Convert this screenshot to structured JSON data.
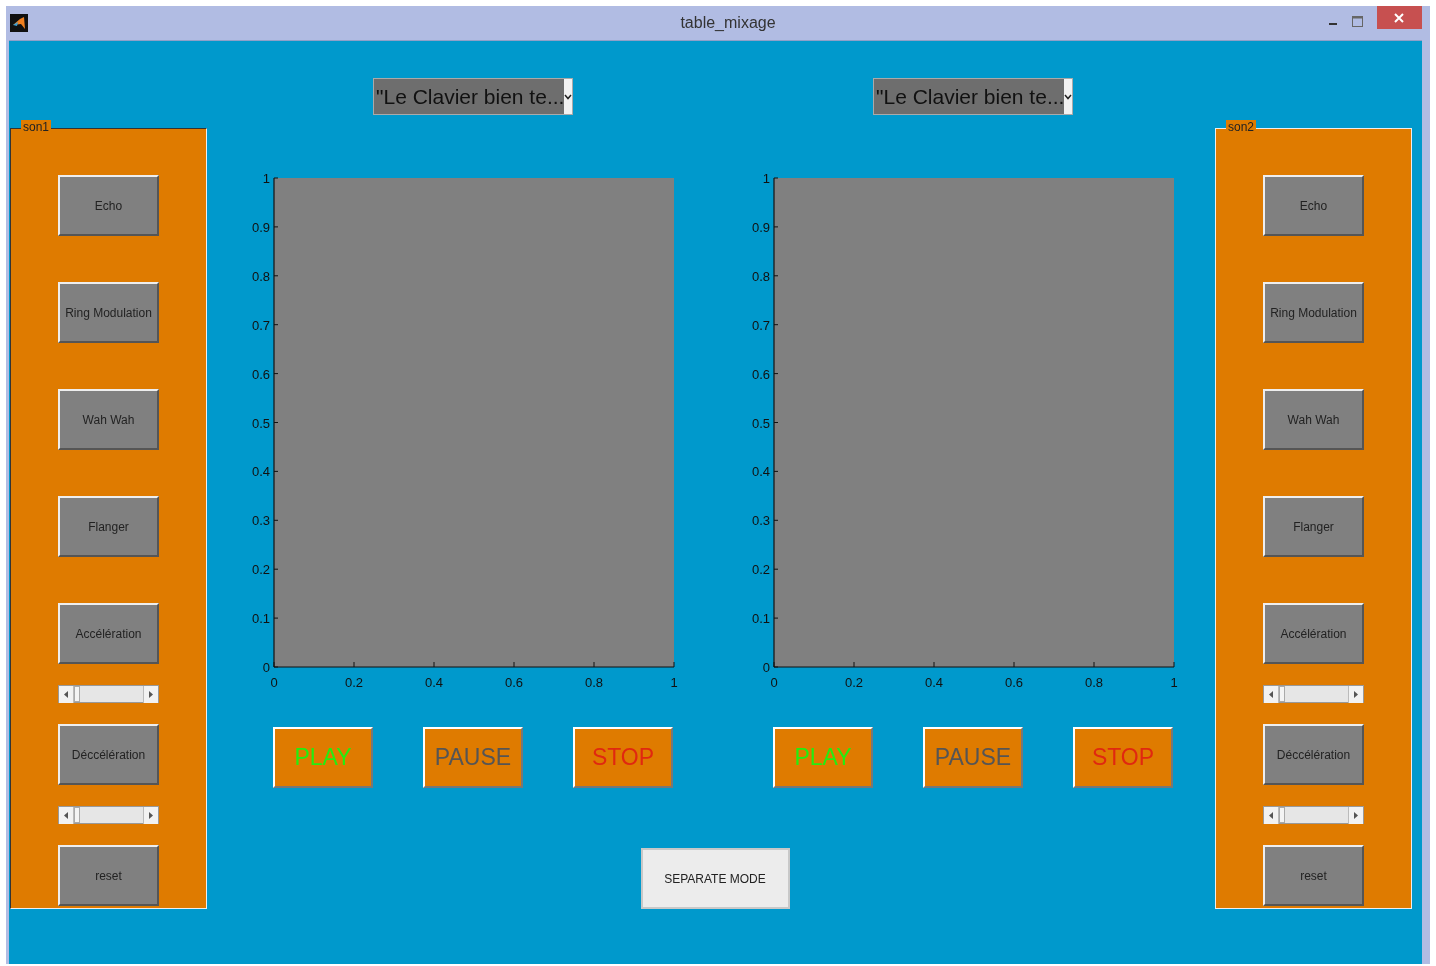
{
  "window": {
    "title": "table_mixage"
  },
  "panels": [
    {
      "title": "son1",
      "items": [
        {
          "kind": "button",
          "label": "Echo"
        },
        {
          "kind": "button",
          "label": "Ring Modulation"
        },
        {
          "kind": "button",
          "label": "Wah Wah"
        },
        {
          "kind": "button",
          "label": "Flanger"
        },
        {
          "kind": "button",
          "label": "Accélération"
        },
        {
          "kind": "slider",
          "level": 0
        },
        {
          "kind": "button",
          "label": "Déccélération"
        },
        {
          "kind": "slider",
          "level": 0
        },
        {
          "kind": "button",
          "label": "reset"
        }
      ]
    },
    {
      "title": "son2",
      "items": [
        {
          "kind": "button",
          "label": "Echo"
        },
        {
          "kind": "button",
          "label": "Ring Modulation"
        },
        {
          "kind": "button",
          "label": "Wah Wah"
        },
        {
          "kind": "button",
          "label": "Flanger"
        },
        {
          "kind": "button",
          "label": "Accélération"
        },
        {
          "kind": "slider",
          "level": 0
        },
        {
          "kind": "button",
          "label": "Déccélération"
        },
        {
          "kind": "slider",
          "level": 0
        },
        {
          "kind": "button",
          "label": "reset"
        }
      ]
    }
  ],
  "players": [
    {
      "track": "\"Le Clavier bien te...",
      "chart_data": {
        "type": "line",
        "xlim": [
          0,
          1
        ],
        "ylim": [
          0,
          1
        ],
        "xticks": [
          0,
          0.2,
          0.4,
          0.6,
          0.8,
          1
        ],
        "yticks": [
          0,
          0.1,
          0.2,
          0.3,
          0.4,
          0.5,
          0.6,
          0.7,
          0.8,
          0.9,
          1
        ]
      },
      "controls": [
        {
          "kind": "play",
          "label": "PLAY"
        },
        {
          "kind": "pause",
          "label": "PAUSE"
        },
        {
          "kind": "stop",
          "label": "STOP"
        }
      ]
    },
    {
      "track": "\"Le Clavier bien te...",
      "chart_data": {
        "type": "line",
        "xlim": [
          0,
          1
        ],
        "ylim": [
          0,
          1
        ],
        "xticks": [
          0,
          0.2,
          0.4,
          0.6,
          0.8,
          1
        ],
        "yticks": [
          0,
          0.1,
          0.2,
          0.3,
          0.4,
          0.5,
          0.6,
          0.7,
          0.8,
          0.9,
          1
        ]
      },
      "controls": [
        {
          "kind": "play",
          "label": "PLAY"
        },
        {
          "kind": "pause",
          "label": "PAUSE"
        },
        {
          "kind": "stop",
          "label": "STOP"
        }
      ]
    }
  ],
  "mode_button": "SEPARATE MODE"
}
